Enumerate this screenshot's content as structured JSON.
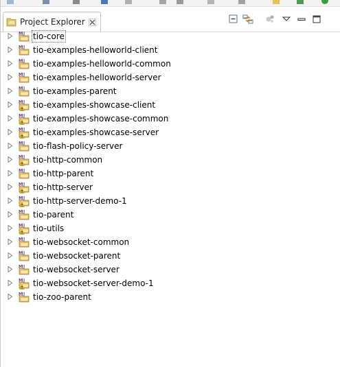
{
  "view": {
    "tab_title": "Project Explorer"
  },
  "icons": {
    "tab": "project-explorer-icon",
    "close": "close-icon",
    "collapse_all": "collapse-all-icon",
    "link_editor": "link-with-editor-icon",
    "view_menu": "view-menu-icon",
    "minimize": "minimize-icon",
    "maximize": "maximize-icon",
    "project": "maven-project-icon",
    "expand": "expand-arrow-icon"
  },
  "colors": {
    "folder": "#e8c469",
    "maven": "#6f3d8f",
    "warning": "#f0c419"
  },
  "projects": [
    {
      "name": "tio-core",
      "warning": false
    },
    {
      "name": "tio-examples-helloworld-client",
      "warning": false
    },
    {
      "name": "tio-examples-helloworld-common",
      "warning": false
    },
    {
      "name": "tio-examples-helloworld-server",
      "warning": false
    },
    {
      "name": "tio-examples-parent",
      "warning": false
    },
    {
      "name": "tio-examples-showcase-client",
      "warning": true
    },
    {
      "name": "tio-examples-showcase-common",
      "warning": true
    },
    {
      "name": "tio-examples-showcase-server",
      "warning": true
    },
    {
      "name": "tio-flash-policy-server",
      "warning": false
    },
    {
      "name": "tio-http-common",
      "warning": true
    },
    {
      "name": "tio-http-parent",
      "warning": false
    },
    {
      "name": "tio-http-server",
      "warning": true
    },
    {
      "name": "tio-http-server-demo-1",
      "warning": true
    },
    {
      "name": "tio-parent",
      "warning": false
    },
    {
      "name": "tio-utils",
      "warning": true
    },
    {
      "name": "tio-websocket-common",
      "warning": false
    },
    {
      "name": "tio-websocket-parent",
      "warning": false
    },
    {
      "name": "tio-websocket-server",
      "warning": false
    },
    {
      "name": "tio-websocket-server-demo-1",
      "warning": true
    },
    {
      "name": "tio-zoo-parent",
      "warning": false
    }
  ]
}
